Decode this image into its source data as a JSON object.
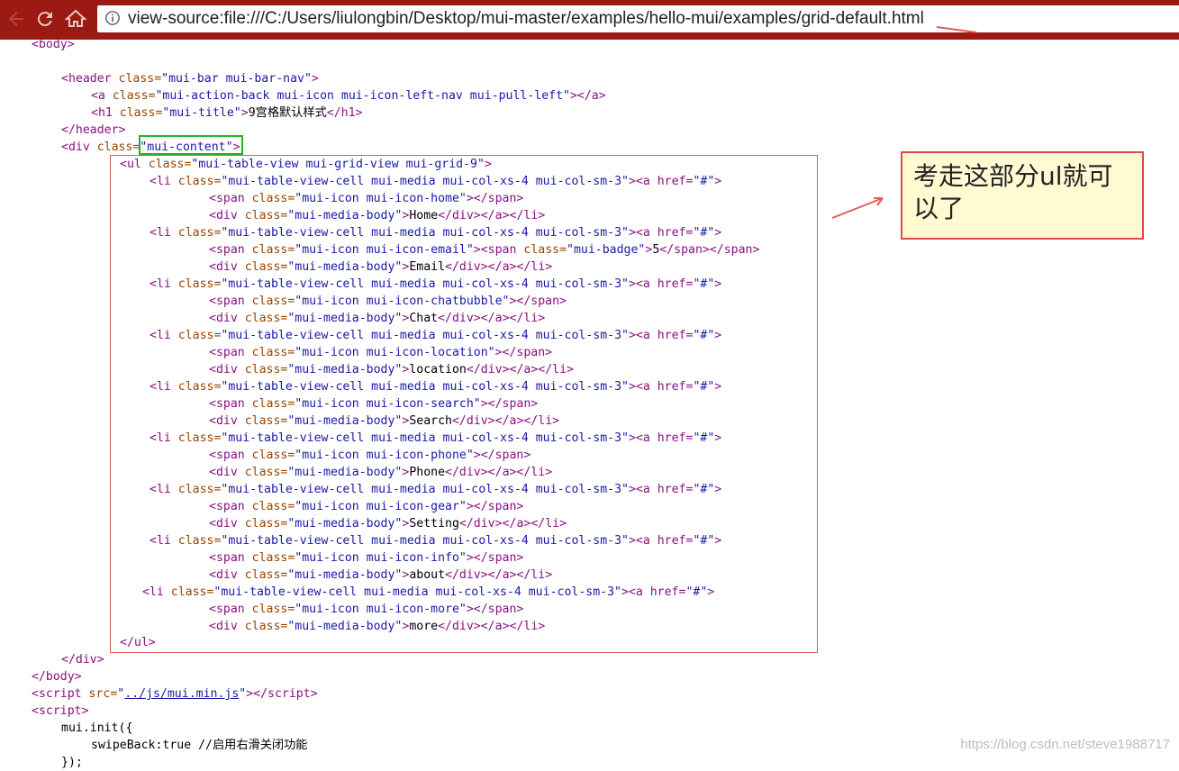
{
  "browser": {
    "url": "view-source:file:///C:/Users/liulongbin/Desktop/mui-master/examples/hello-mui/examples/grid-default.html",
    "icons": [
      "back-arrow-icon",
      "reload-icon",
      "home-icon",
      "info-icon"
    ]
  },
  "source": {
    "body_open": "<body>",
    "header_open_tag": "<header",
    "header_class_attr": " class=",
    "header_class_val": "\"mui-bar mui-bar-nav\"",
    "a_tag": "<a",
    "a_class_val": "\"mui-action-back mui-icon mui-icon-left-nav mui-pull-left\"",
    "a_close": "></a>",
    "h1_tag": "<h1",
    "h1_class_val": "\"mui-title\"",
    "h1_text": "9宫格默认样式",
    "h1_close": "</h1>",
    "header_close": "</header>",
    "div_tag": "<div",
    "div_class_val": "\"mui-content\"",
    "ul_tag": "<ul",
    "ul_class_val": "\"mui-table-view mui-grid-view mui-grid-9\"",
    "li_tag": "<li",
    "li_class_val": "\"mui-table-view-cell mui-media mui-col-xs-4 mui-col-sm-3\"",
    "a_href_attr": "><a href=",
    "a_href_val": "\"#\"",
    "span_tag": "<span",
    "media_body_val": "\"mui-media-body\"",
    "items": [
      {
        "icon_class": "\"mui-icon mui-icon-home\"",
        "label": "Home"
      },
      {
        "icon_class": "\"mui-icon mui-icon-email\"",
        "label": "Email",
        "badge_class": "\"mui-badge\"",
        "badge": "5"
      },
      {
        "icon_class": "\"mui-icon mui-icon-chatbubble\"",
        "label": "Chat"
      },
      {
        "icon_class": "\"mui-icon mui-icon-location\"",
        "label": "location"
      },
      {
        "icon_class": "\"mui-icon mui-icon-search\"",
        "label": "Search"
      },
      {
        "icon_class": "\"mui-icon mui-icon-phone\"",
        "label": "Phone"
      },
      {
        "icon_class": "\"mui-icon mui-icon-gear\"",
        "label": "Setting"
      },
      {
        "icon_class": "\"mui-icon mui-icon-info\"",
        "label": "about"
      },
      {
        "icon_class": "\"mui-icon mui-icon-more\"",
        "label": "more"
      }
    ],
    "ul_close": "</ul>",
    "div_close": "</div>",
    "body_close": "</body>",
    "script_src_val": "\"../js/mui.min.js\"",
    "script_src_link": "../js/mui.min.js",
    "script_open": "<script>",
    "mui_init": "mui.init({",
    "swipe_back": "swipeBack:true //启用右滑关闭功能",
    "closing": "});"
  },
  "annotation": {
    "callout_text": "考走这部分ul就可以了",
    "colors": {
      "red_box": "#e35b5b",
      "green_box": "#1fb31f",
      "callout_bg": "#fffad2"
    }
  },
  "watermark": "https://blog.csdn.net/steve1988717"
}
